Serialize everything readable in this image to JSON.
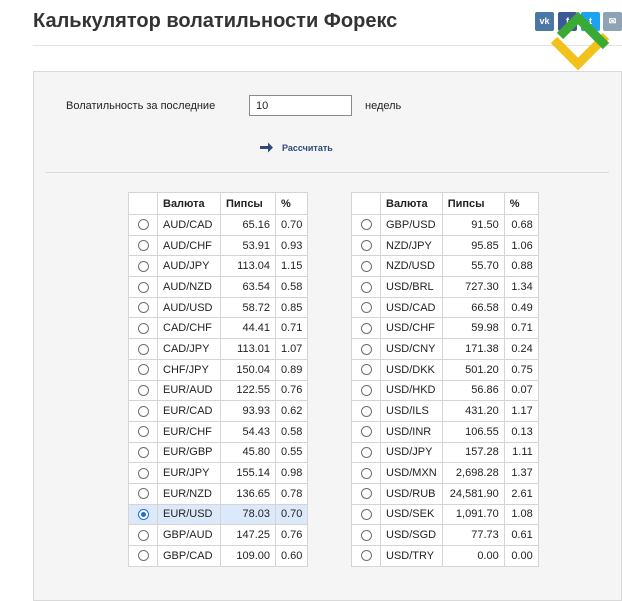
{
  "page": {
    "title": "Калькулятор волатильности Форекс",
    "share": [
      {
        "label": "vk",
        "icon": "vk-icon"
      },
      {
        "label": "f",
        "icon": "facebook-icon"
      },
      {
        "label": "t",
        "icon": "twitter-icon"
      },
      {
        "label": "✉",
        "icon": "mail-icon"
      }
    ],
    "logo_icon": "litefinance-logo-icon",
    "colors": {
      "logo_green": "#3aaa35",
      "logo_yellow": "#f2c21b",
      "accent": "#2e4a75",
      "selected_row": "#dbe9fb",
      "radio": "#1a6ed8"
    }
  },
  "form": {
    "label": "Волатильность за последние",
    "weeks_value": "10",
    "weeks_unit": "недель",
    "calculate_label": "Рассчитать",
    "calculate_icon": "arrow-right-icon"
  },
  "table_headers": [
    "Валюта",
    "Пипсы",
    "%"
  ],
  "left_rows": [
    {
      "pair": "AUD/CAD",
      "pips": "65.16",
      "pct": "0.70",
      "selected": false
    },
    {
      "pair": "AUD/CHF",
      "pips": "53.91",
      "pct": "0.93",
      "selected": false
    },
    {
      "pair": "AUD/JPY",
      "pips": "113.04",
      "pct": "1.15",
      "selected": false
    },
    {
      "pair": "AUD/NZD",
      "pips": "63.54",
      "pct": "0.58",
      "selected": false
    },
    {
      "pair": "AUD/USD",
      "pips": "58.72",
      "pct": "0.85",
      "selected": false
    },
    {
      "pair": "CAD/CHF",
      "pips": "44.41",
      "pct": "0.71",
      "selected": false
    },
    {
      "pair": "CAD/JPY",
      "pips": "113.01",
      "pct": "1.07",
      "selected": false
    },
    {
      "pair": "CHF/JPY",
      "pips": "150.04",
      "pct": "0.89",
      "selected": false
    },
    {
      "pair": "EUR/AUD",
      "pips": "122.55",
      "pct": "0.76",
      "selected": false
    },
    {
      "pair": "EUR/CAD",
      "pips": "93.93",
      "pct": "0.62",
      "selected": false
    },
    {
      "pair": "EUR/CHF",
      "pips": "54.43",
      "pct": "0.58",
      "selected": false
    },
    {
      "pair": "EUR/GBP",
      "pips": "45.80",
      "pct": "0.55",
      "selected": false
    },
    {
      "pair": "EUR/JPY",
      "pips": "155.14",
      "pct": "0.98",
      "selected": false
    },
    {
      "pair": "EUR/NZD",
      "pips": "136.65",
      "pct": "0.78",
      "selected": false
    },
    {
      "pair": "EUR/USD",
      "pips": "78.03",
      "pct": "0.70",
      "selected": true
    },
    {
      "pair": "GBP/AUD",
      "pips": "147.25",
      "pct": "0.76",
      "selected": false
    },
    {
      "pair": "GBP/CAD",
      "pips": "109.00",
      "pct": "0.60",
      "selected": false
    }
  ],
  "right_rows": [
    {
      "pair": "GBP/USD",
      "pips": "91.50",
      "pct": "0.68",
      "selected": false
    },
    {
      "pair": "NZD/JPY",
      "pips": "95.85",
      "pct": "1.06",
      "selected": false
    },
    {
      "pair": "NZD/USD",
      "pips": "55.70",
      "pct": "0.88",
      "selected": false
    },
    {
      "pair": "USD/BRL",
      "pips": "727.30",
      "pct": "1.34",
      "selected": false
    },
    {
      "pair": "USD/CAD",
      "pips": "66.58",
      "pct": "0.49",
      "selected": false
    },
    {
      "pair": "USD/CHF",
      "pips": "59.98",
      "pct": "0.71",
      "selected": false
    },
    {
      "pair": "USD/CNY",
      "pips": "171.38",
      "pct": "0.24",
      "selected": false
    },
    {
      "pair": "USD/DKK",
      "pips": "501.20",
      "pct": "0.75",
      "selected": false
    },
    {
      "pair": "USD/HKD",
      "pips": "56.86",
      "pct": "0.07",
      "selected": false
    },
    {
      "pair": "USD/ILS",
      "pips": "431.20",
      "pct": "1.17",
      "selected": false
    },
    {
      "pair": "USD/INR",
      "pips": "106.55",
      "pct": "0.13",
      "selected": false
    },
    {
      "pair": "USD/JPY",
      "pips": "157.28",
      "pct": "1.11",
      "selected": false
    },
    {
      "pair": "USD/MXN",
      "pips": "2,698.28",
      "pct": "1.37",
      "selected": false
    },
    {
      "pair": "USD/RUB",
      "pips": "24,581.90",
      "pct": "2.61",
      "selected": false
    },
    {
      "pair": "USD/SEK",
      "pips": "1,091.70",
      "pct": "1.08",
      "selected": false
    },
    {
      "pair": "USD/SGD",
      "pips": "77.73",
      "pct": "0.61",
      "selected": false
    },
    {
      "pair": "USD/TRY",
      "pips": "0.00",
      "pct": "0.00",
      "selected": false
    }
  ]
}
